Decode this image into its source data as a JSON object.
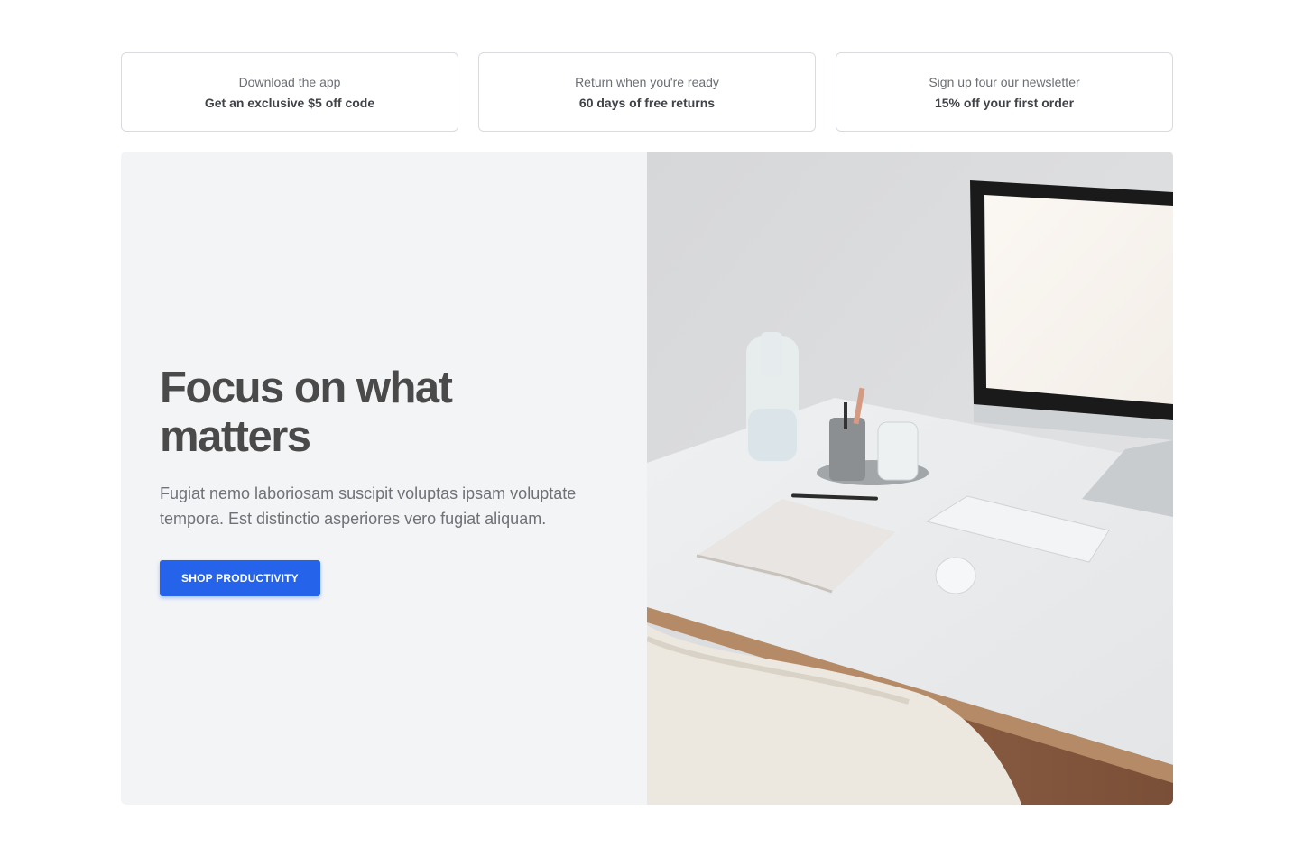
{
  "perks": [
    {
      "title": "Download the app",
      "subtitle": "Get an exclusive $5 off code"
    },
    {
      "title": "Return when you're ready",
      "subtitle": "60 days of free returns"
    },
    {
      "title": "Sign up four our newsletter",
      "subtitle": "15% off your first order"
    }
  ],
  "hero": {
    "title": "Focus on what matters",
    "description": "Fugiat nemo laboriosam suscipit voluptas ipsam voluptate tempora. Est distinctio asperiores vero fugiat aliquam.",
    "cta_label": "SHOP PRODUCTIVITY",
    "image_icon": "desk-workspace-photo"
  },
  "colors": {
    "accent": "#2563eb",
    "hero_panel_bg": "#f3f4f6",
    "border": "#d9dbe0"
  }
}
